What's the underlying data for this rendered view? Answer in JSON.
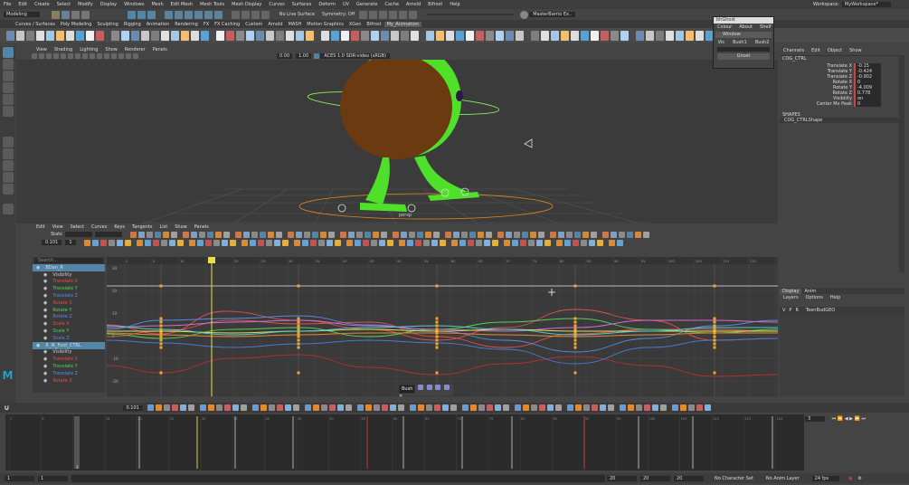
{
  "menubar": {
    "items": [
      "File",
      "Edit",
      "Create",
      "Select",
      "Modify",
      "Display",
      "Windows",
      "Mesh",
      "Edit Mesh",
      "Mesh Tools",
      "Mesh Display",
      "Curves",
      "Surfaces",
      "Deform",
      "UV",
      "Generate",
      "Cache",
      "Arnold",
      "Bifrost",
      "Help"
    ],
    "workspace_label": "Workspace:",
    "workspace_value": "MyWorkspace*"
  },
  "statusline": {
    "mode": "Modeling",
    "no_live": "No Live Surface",
    "symmetry": "Symmetry: Off",
    "user": "MasterBarrio Ex.."
  },
  "shelf": {
    "tabs": [
      "Curves / Surfaces",
      "Poly Modeling",
      "Sculpting",
      "Rigging",
      "Animation",
      "Rendering",
      "FX",
      "FX Caching",
      "Custom",
      "Arnold",
      "MASH",
      "Motion Graphics",
      "XGen",
      "Bifrost",
      "My_Animation"
    ],
    "icon_labels": [
      "Anim",
      "Key",
      "Pose",
      "Tools",
      "Smooth",
      "Sel",
      "Set",
      "Mirror",
      "Picker",
      "Sculpt"
    ]
  },
  "floating_window": {
    "title": "bhGhost",
    "menu": [
      "Colour",
      "About",
      "Shelf"
    ],
    "section": "Window",
    "cols": [
      "Vis",
      "Bush1",
      "Bush2"
    ],
    "button": "Ghost"
  },
  "viewport": {
    "menu": [
      "View",
      "Shading",
      "Lighting",
      "Show",
      "Renderer",
      "Panels"
    ],
    "field1": "0.00",
    "field2": "1.00",
    "colorspace": "ACES 1.0 SDR-video (sRGB)",
    "persp_label": "persp"
  },
  "graph_editor": {
    "menu": [
      "Edit",
      "View",
      "Select",
      "Curves",
      "Keys",
      "Tangents",
      "List",
      "Show",
      "Panels"
    ],
    "stats_label": "Stats",
    "frame_field": "0.101",
    "value_field": "1",
    "search_placeholder": "Search...",
    "outliner": [
      {
        "label": "BDan_R",
        "type": "group"
      },
      {
        "label": "Visibility",
        "type": "vis"
      },
      {
        "label": "Translate X",
        "type": "x"
      },
      {
        "label": "Translate Y",
        "type": "y"
      },
      {
        "label": "Translate Z",
        "type": "z"
      },
      {
        "label": "Rotate X",
        "type": "x"
      },
      {
        "label": "Rotate Y",
        "type": "y"
      },
      {
        "label": "Rotate Z",
        "type": "z"
      },
      {
        "label": "Scale X",
        "type": "x"
      },
      {
        "label": "Scale Y",
        "type": "y"
      },
      {
        "label": "Scale Z",
        "type": "z"
      },
      {
        "label": "R_IK_Foot_CTRL",
        "type": "group"
      },
      {
        "label": "Visibility",
        "type": "vis"
      },
      {
        "label": "Translate X",
        "type": "x"
      },
      {
        "label": "Translate Y",
        "type": "y"
      },
      {
        "label": "Translate Z",
        "type": "z"
      },
      {
        "label": "Rotate X",
        "type": "x"
      }
    ],
    "y_ticks": [
      "30",
      "20",
      "10",
      "0",
      "-10",
      "-20"
    ],
    "x_ticks": [
      "1",
      "5",
      "10",
      "15",
      "20",
      "25",
      "30",
      "35",
      "40",
      "45",
      "50",
      "55",
      "60",
      "65",
      "70",
      "75",
      "80",
      "85",
      "90",
      "95",
      "100",
      "105",
      "110",
      "115",
      "120"
    ],
    "bush_label": "Bush"
  },
  "channel_box": {
    "menu": [
      "Channels",
      "Edit",
      "Object",
      "Show"
    ],
    "object": "COG_CTRL",
    "channels": [
      {
        "label": "Translate X",
        "value": "-0.15"
      },
      {
        "label": "Translate Y",
        "value": "-0.424"
      },
      {
        "label": "Translate Z",
        "value": "-0.902"
      },
      {
        "label": "Rotate X",
        "value": "0"
      },
      {
        "label": "Rotate Y",
        "value": "-4.009"
      },
      {
        "label": "Rotate Z",
        "value": "0.778"
      },
      {
        "label": "Visibility",
        "value": "on"
      },
      {
        "label": "Center Mx Peak",
        "value": "0"
      }
    ],
    "shapes_label": "SHAPES",
    "shape_name": "COG_CTRLShape"
  },
  "layer_editor": {
    "tabs": [
      "Display",
      "Anim"
    ],
    "menu": [
      "Layers",
      "Options",
      "Help"
    ],
    "layer_name": "TeenBudGEO",
    "flags": [
      "V",
      "P",
      "R"
    ]
  },
  "timeslider": {
    "ticks": [
      "1",
      "5",
      "10",
      "15",
      "20",
      "25",
      "30",
      "35",
      "40",
      "45",
      "50",
      "55",
      "60",
      "65",
      "70",
      "75",
      "80",
      "85",
      "90",
      "95",
      "100",
      "105",
      "110",
      "115",
      "120"
    ],
    "current": "3",
    "current_field": "3"
  },
  "rangeslider": {
    "start": "1",
    "inner_start": "1",
    "inner_end": "20",
    "end": "20",
    "max": "20",
    "character_set": "No Character Set",
    "anim_layer": "No Anim Layer",
    "fps": "24 fps"
  },
  "colors": {
    "accent": "#5285a6",
    "key": "#f2a82d",
    "current_time": "#e8e04a",
    "body_green": "#4fe02a",
    "body_brown": "#6b3a10"
  }
}
